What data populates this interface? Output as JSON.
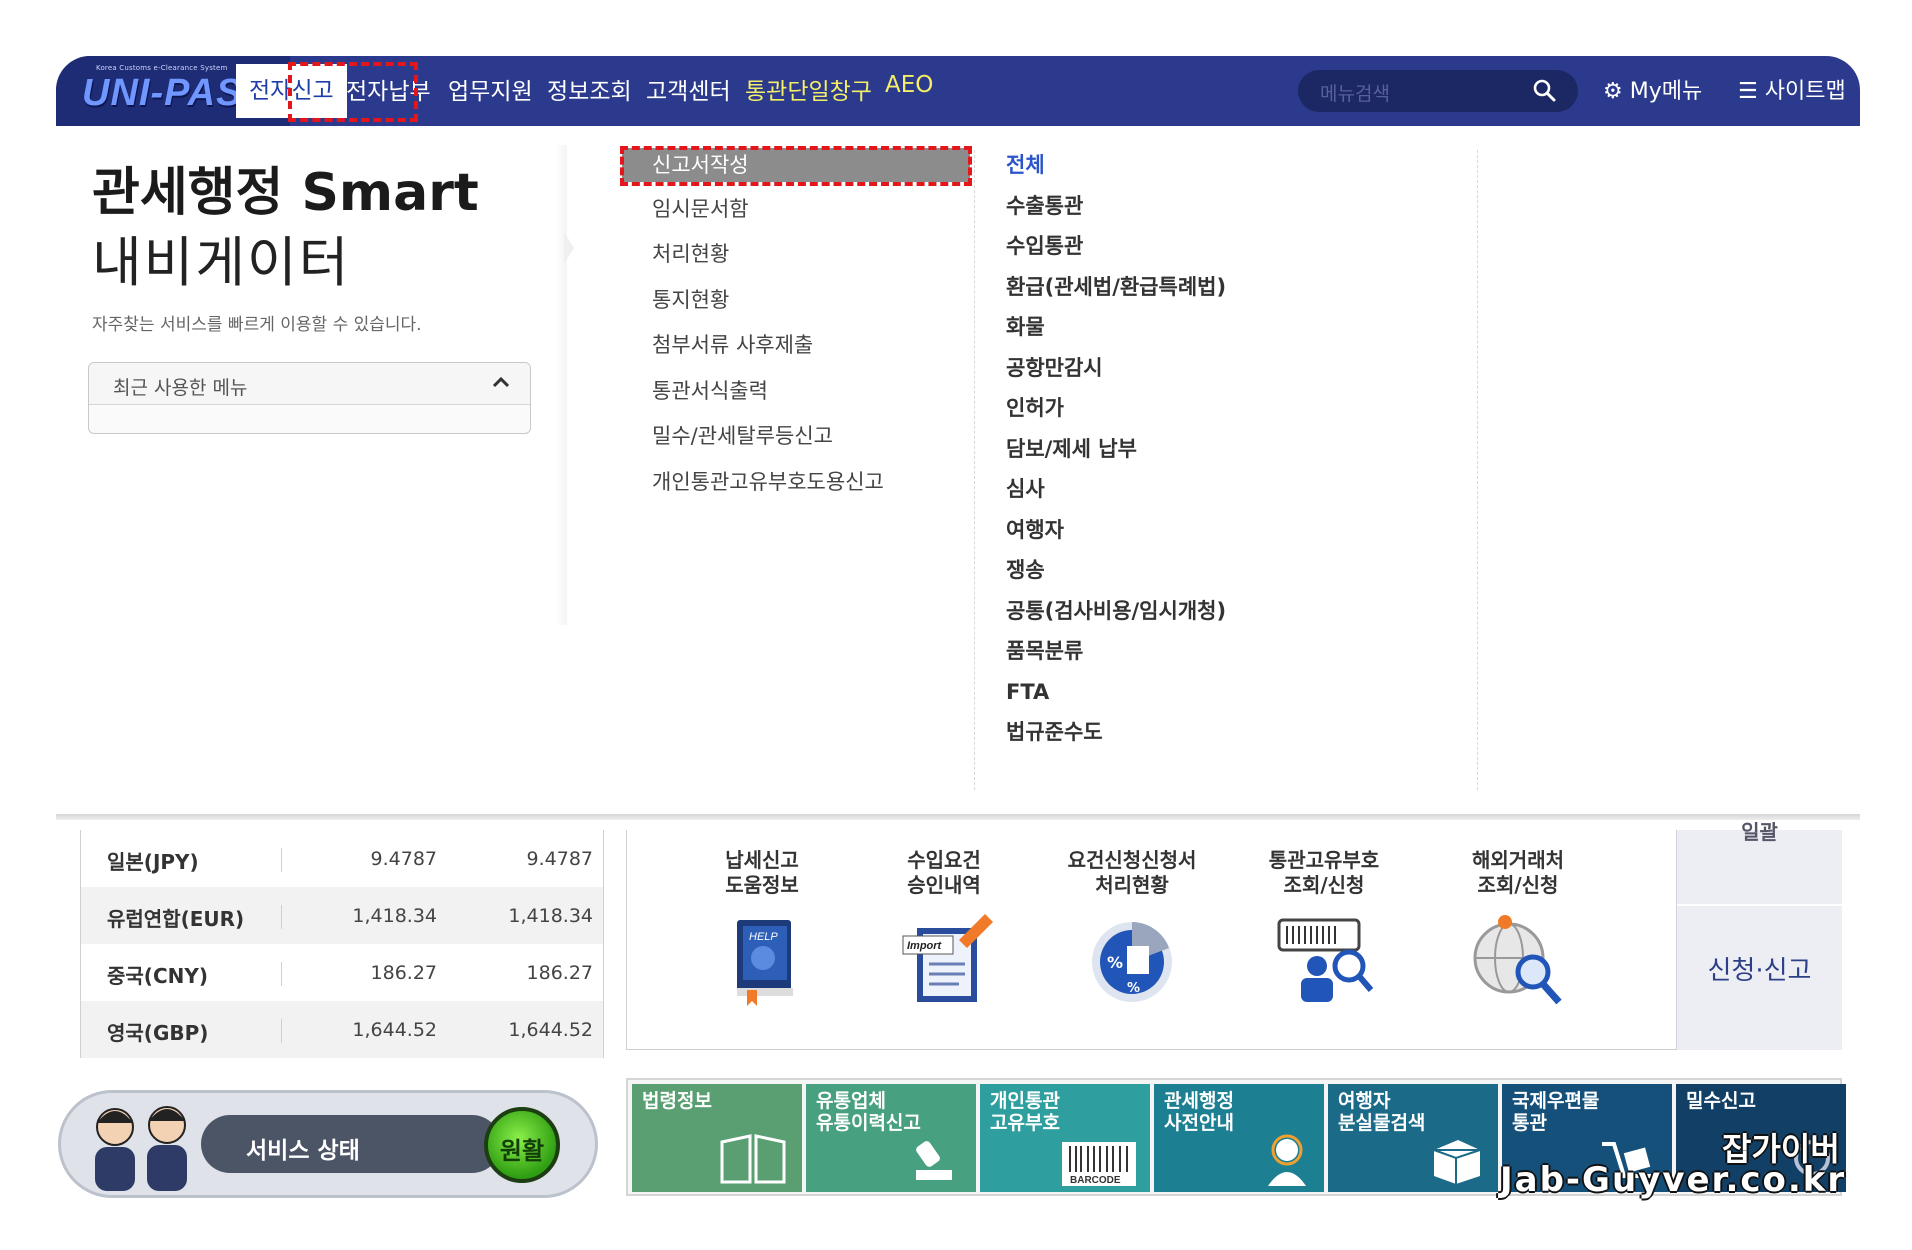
{
  "nav": {
    "logo_small": "Korea Customs e-Clearance System",
    "logo_main": "UNI-PASS",
    "items": [
      {
        "label": "전자신고",
        "active": true
      },
      {
        "label": "전자납부"
      },
      {
        "label": "업무지원"
      },
      {
        "label": "정보조회"
      },
      {
        "label": "고객센터"
      },
      {
        "label": "통관단일창구",
        "highlight": true
      },
      {
        "label": "AEO",
        "highlight": true
      }
    ],
    "search_placeholder": "메뉴검색",
    "my_menu": "My메뉴",
    "site_map": "사이트맵"
  },
  "left_panel": {
    "title": "관세행정 Smart",
    "subtitle": "내비게이터",
    "description": "자주찾는 서비스를 빠르게 이용할 수 있습니다.",
    "recent_menu_label": "최근 사용한 메뉴"
  },
  "submenu": {
    "col1": [
      "신고서작성",
      "임시문서함",
      "처리현황",
      "통지현황",
      "첨부서류 사후제출",
      "통관서식출력",
      "밀수/관세탈루등신고",
      "개인통관고유부호도용신고"
    ],
    "col1_selected_index": 0,
    "col2": [
      "전체",
      "수출통관",
      "수입통관",
      "환급(관세법/환급특례법)",
      "화물",
      "공항만감시",
      "인허가",
      "담보/제세 납부",
      "심사",
      "여행자",
      "쟁송",
      "공통(검사비용/임시개청)",
      "품목분류",
      "FTA",
      "법규준수도"
    ]
  },
  "rates": [
    {
      "name": "일본(JPY)",
      "v1": "9.4787",
      "v2": "9.4787"
    },
    {
      "name": "유럽연합(EUR)",
      "v1": "1,418.34",
      "v2": "1,418.34"
    },
    {
      "name": "중국(CNY)",
      "v1": "186.27",
      "v2": "186.27"
    },
    {
      "name": "영국(GBP)",
      "v1": "1,644.52",
      "v2": "1,644.52"
    }
  ],
  "services": [
    {
      "label1": "납세신고",
      "label2": "도움정보",
      "icon": "help-book-icon",
      "icon_text": "HELP"
    },
    {
      "label1": "수입요건",
      "label2": "승인내역",
      "icon": "import-document-icon",
      "icon_text": "Import"
    },
    {
      "label1": "요건신청신청서",
      "label2": "처리현황",
      "icon": "percent-chart-icon"
    },
    {
      "label1": "통관고유부호",
      "label2": "조회/신청",
      "icon": "barcode-search-icon"
    },
    {
      "label1": "해외거래처",
      "label2": "조회/신청",
      "icon": "globe-search-icon"
    }
  ],
  "side_tabs": {
    "top_partial": "일괄",
    "main": "신청·신고"
  },
  "status": {
    "label": "서비스 상태",
    "value": "원활"
  },
  "tiles": [
    {
      "line1": "법령정보",
      "line2": "",
      "color": "#5a9f72",
      "icon": "book-icon"
    },
    {
      "line1": "유통업체",
      "line2": "유통이력신고",
      "color": "#47a07f",
      "icon": "stamp-icon"
    },
    {
      "line1": "개인통관",
      "line2": "고유부호",
      "color": "#2f9e9f",
      "icon": "barcode-icon",
      "icon_text": "BARCODE"
    },
    {
      "line1": "관세행정",
      "line2": "사전안내",
      "color": "#1c7f92",
      "icon": "agent-icon"
    },
    {
      "line1": "여행자",
      "line2": "분실물검색",
      "color": "#1b6a88",
      "icon": "box-icon"
    },
    {
      "line1": "국제우편물",
      "line2": "통관",
      "color": "#15507a",
      "icon": "cart-icon"
    },
    {
      "line1": "밀수신고",
      "line2": "",
      "color": "#123f66",
      "icon": "phone-icon"
    }
  ],
  "watermark": {
    "line1": "잡가이버",
    "line2": "Jab-Guyver.co.kr"
  },
  "colors": {
    "nav_bg": "#2b3a8c",
    "highlight_red": "#e3161b",
    "accent_blue": "#2b55c8",
    "nav_yellow": "#f5ee67"
  }
}
